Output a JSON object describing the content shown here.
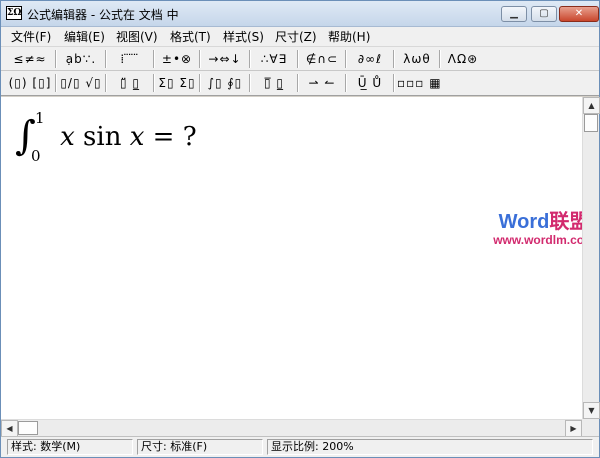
{
  "window": {
    "icon_label": "ΣΩ",
    "title": "公式编辑器 - 公式在 文档  中",
    "minimize_glyph": "▁",
    "maximize_glyph": "▢",
    "close_glyph": "✕"
  },
  "menu": {
    "items": [
      "文件(F)",
      "编辑(E)",
      "视图(V)",
      "格式(T)",
      "样式(S)",
      "尺寸(Z)",
      "帮助(H)"
    ]
  },
  "toolbar_row1": [
    "≤≠≈",
    "ạb∵.",
    "⁞ ̈ ̈ ̈",
    "±•⊗",
    "→⇔↓",
    "∴∀∃",
    "∉∩⊂",
    "∂∞ℓ",
    "λωθ",
    "ΛΩ⊛"
  ],
  "toolbar_row2": [
    "(▯) [▯]",
    "▯/▯ √▯",
    "▯̈ ▯̲",
    "Σ▯ Σ▯",
    "∫▯ ∮▯",
    "▯̅ ▯̲",
    "⇀ ↼",
    "Ū̲ Ů",
    "▫▫▫ ▦"
  ],
  "formula": {
    "integral": "∫",
    "upper_limit": "1",
    "lower_limit": "0",
    "var": "x",
    "func": " sin ",
    "arg": "x",
    "rest": " = ?"
  },
  "watermark": {
    "brand_en": "Word",
    "brand_cn": "联盟",
    "url": "www.wordlm.com"
  },
  "status": {
    "style": "样式: 数学(M)",
    "size": "尺寸: 标准(F)",
    "zoom": "显示比例: 200%"
  }
}
